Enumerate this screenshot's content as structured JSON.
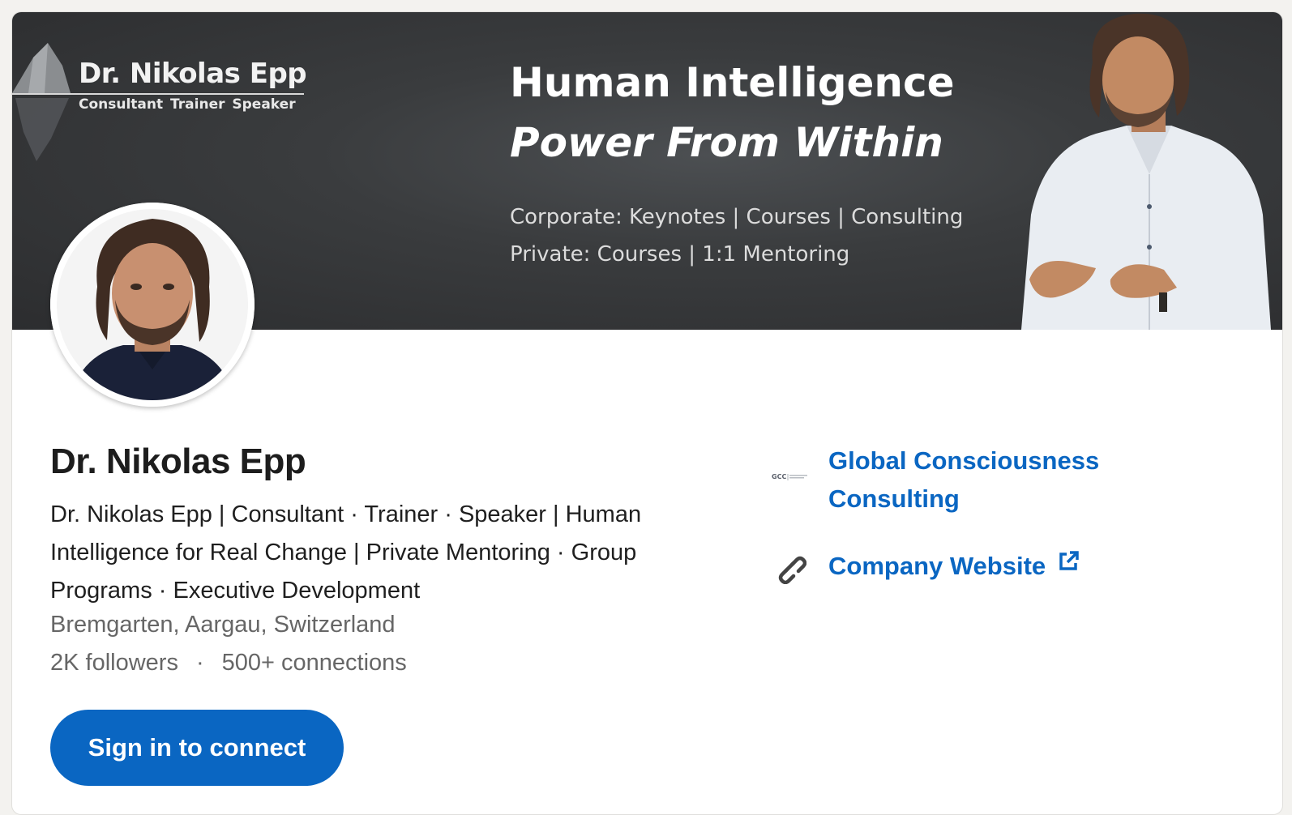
{
  "banner": {
    "brand_name": "Dr. Nikolas Epp",
    "brand_tagline": "Consultant  Trainer  Speaker",
    "title": "Human Intelligence",
    "subtitle": "Power From Within",
    "line1": "Corporate: Keynotes | Courses | Consulting",
    "line2": "Private: Courses | 1:1 Mentoring",
    "icons": [
      "iceberg-logo-icon",
      "speaker-photo"
    ]
  },
  "profile": {
    "name": "Dr. Nikolas Epp",
    "headline": "Dr. Nikolas Epp | Consultant · Trainer · Speaker | Human Intelligence for Real Change | Private Mentoring · Group Programs · Executive Development",
    "location": "Bremgarten, Aargau, Switzerland",
    "followers": "2K followers",
    "separator": "·",
    "connections": "500+ connections",
    "connect_button": "Sign in to connect"
  },
  "sidebar": {
    "company_logo_text": "GCC",
    "company_name": "Global Consciousness Consulting",
    "website_label": "Company Website",
    "icons": [
      "company-logo",
      "link-icon",
      "external-link-icon"
    ]
  },
  "colors": {
    "accent": "#0a66c2",
    "banner_bg": "#3a3c3e",
    "text_primary": "#1d1d1d",
    "text_secondary": "#666666"
  }
}
